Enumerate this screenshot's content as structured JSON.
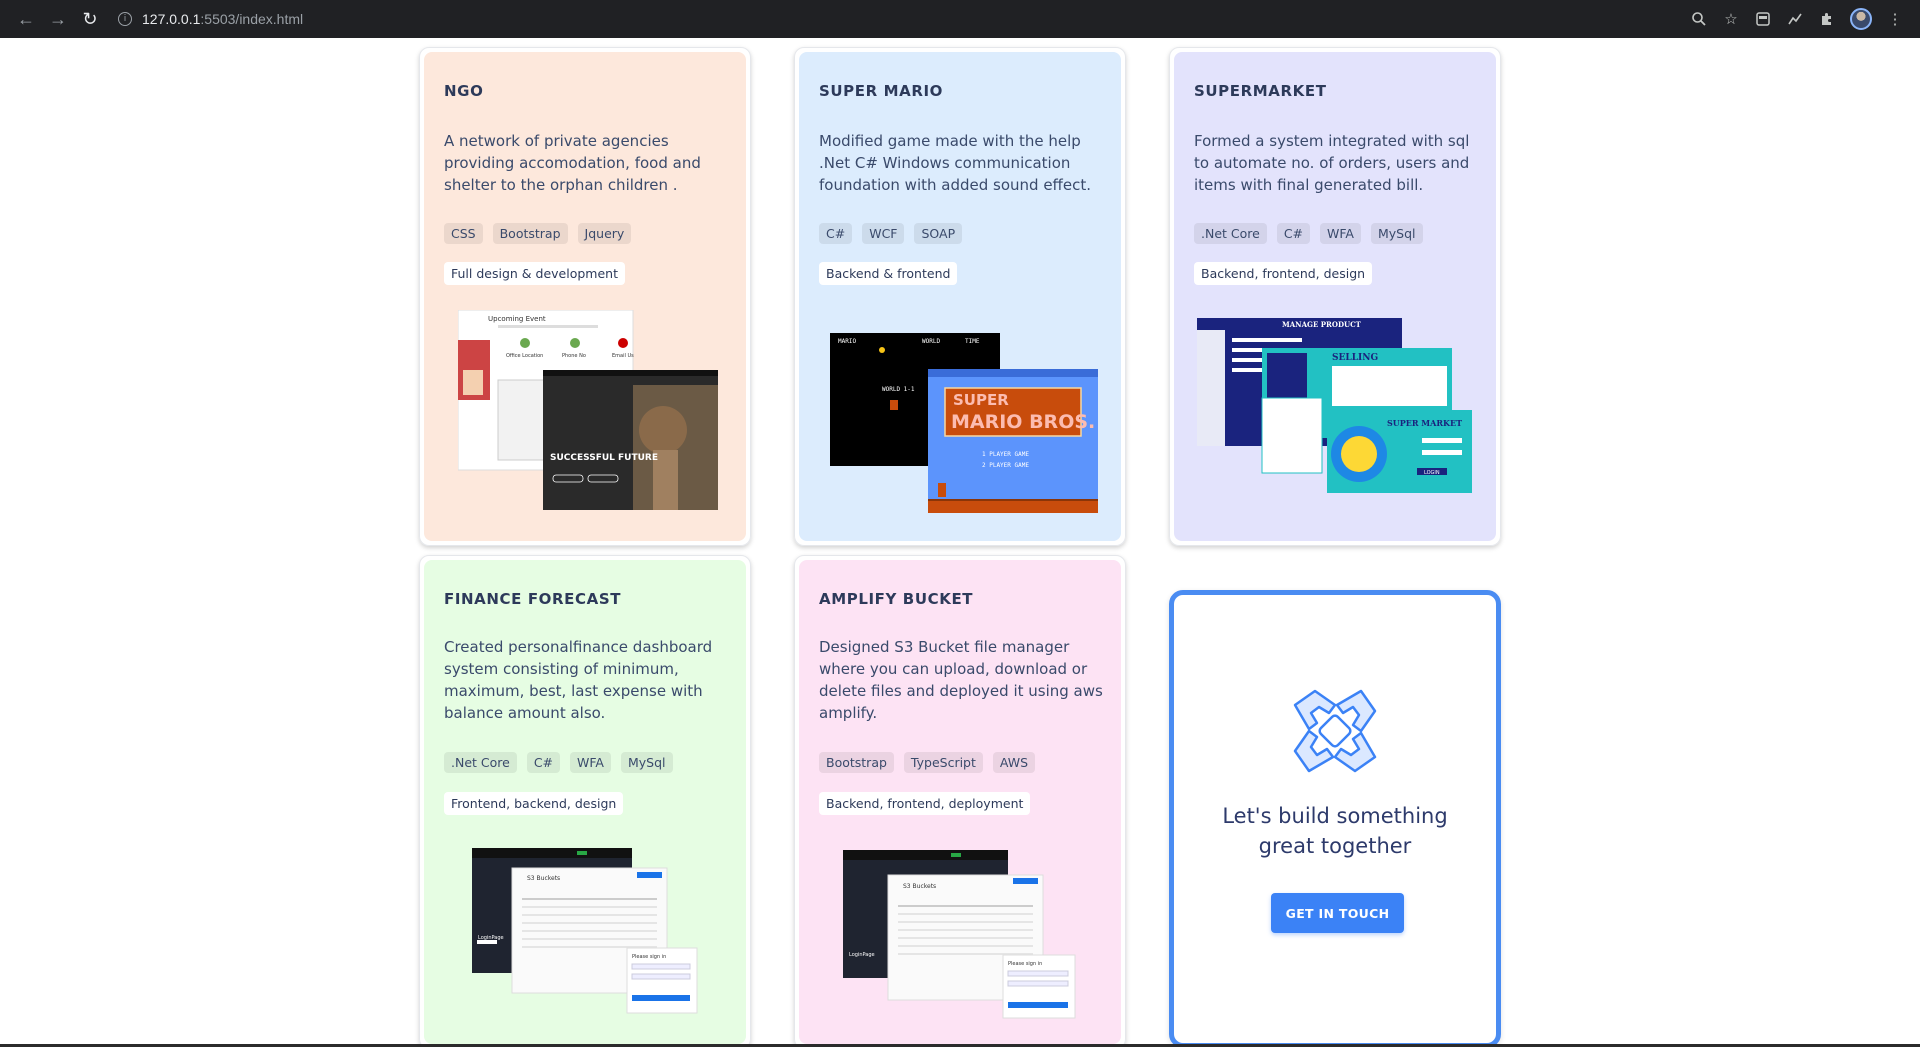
{
  "browser": {
    "url_host": "127.0.0.1",
    "url_rest": ":5503/index.html"
  },
  "projects": [
    {
      "title": "NGO",
      "description": "A network of private agencies providing accomodation, food and shelter to the orphan children .",
      "tags": [
        "CSS",
        "Bootstrap",
        "Jquery"
      ],
      "role": "Full design & development",
      "bg_color": "#fde8dc",
      "shot_texts": {
        "event_title": "Upcoming Event",
        "office": "Office Location",
        "phone": "Phone No",
        "email": "Email Us",
        "hero": "SUCCESSFUL FUTURE"
      }
    },
    {
      "title": "SUPER MARIO",
      "description": "Modified game made with the help .Net C# Windows communication foundation with added sound effect.",
      "tags": [
        "C#",
        "WCF",
        "SOAP"
      ],
      "role": "Backend & frontend",
      "bg_color": "#dcecfd",
      "shot_texts": {
        "mario": "MARIO",
        "world": "WORLD",
        "time": "TIME",
        "world11": "WORLD 1-1",
        "logo1": "SUPER",
        "logo2": "MARIO BROS.",
        "p1": "1 PLAYER GAME",
        "p2": "2 PLAYER GAME"
      }
    },
    {
      "title": "SUPERMARKET",
      "description": "Formed a system integrated with sql to automate no. of orders, users and items with final generated bill.",
      "tags": [
        ".Net Core",
        "C#",
        "WFA",
        "MySql"
      ],
      "role": "Backend, frontend, design",
      "bg_color": "#e3e3fc",
      "shot_texts": {
        "manage": "MANAGE PRODUCT",
        "selling": "SELLING",
        "market": "SUPER MARKET",
        "login": "LOGIN"
      }
    },
    {
      "title": "FINANCE FORECAST",
      "description": "Created personalfinance dashboard system consisting of minimum, maximum, best, last expense with balance amount also.",
      "tags": [
        ".Net Core",
        "C#",
        "WFA",
        "MySql"
      ],
      "role": "Frontend, backend, design",
      "bg_color": "#e6fde3",
      "shot_texts": {
        "buckets": "S3 Buckets",
        "login": "LoginPage",
        "signin": "Please sign in"
      }
    },
    {
      "title": "AMPLIFY BUCKET",
      "description": "Designed S3 Bucket file manager where you can upload, download or delete files and deployed it using aws amplify.",
      "tags": [
        "Bootstrap",
        "TypeScript",
        "AWS"
      ],
      "role": "Backend, frontend, deployment",
      "bg_color": "#fde3f4",
      "shot_texts": {
        "buckets": "S3 Buckets",
        "login": "LoginPage",
        "signin": "Please sign in"
      }
    }
  ],
  "cta": {
    "text_line1": "Let's build something",
    "text_line2": "great together",
    "button": "GET IN TOUCH",
    "accent": "#3b82f6",
    "icon": "hands-together-icon"
  }
}
